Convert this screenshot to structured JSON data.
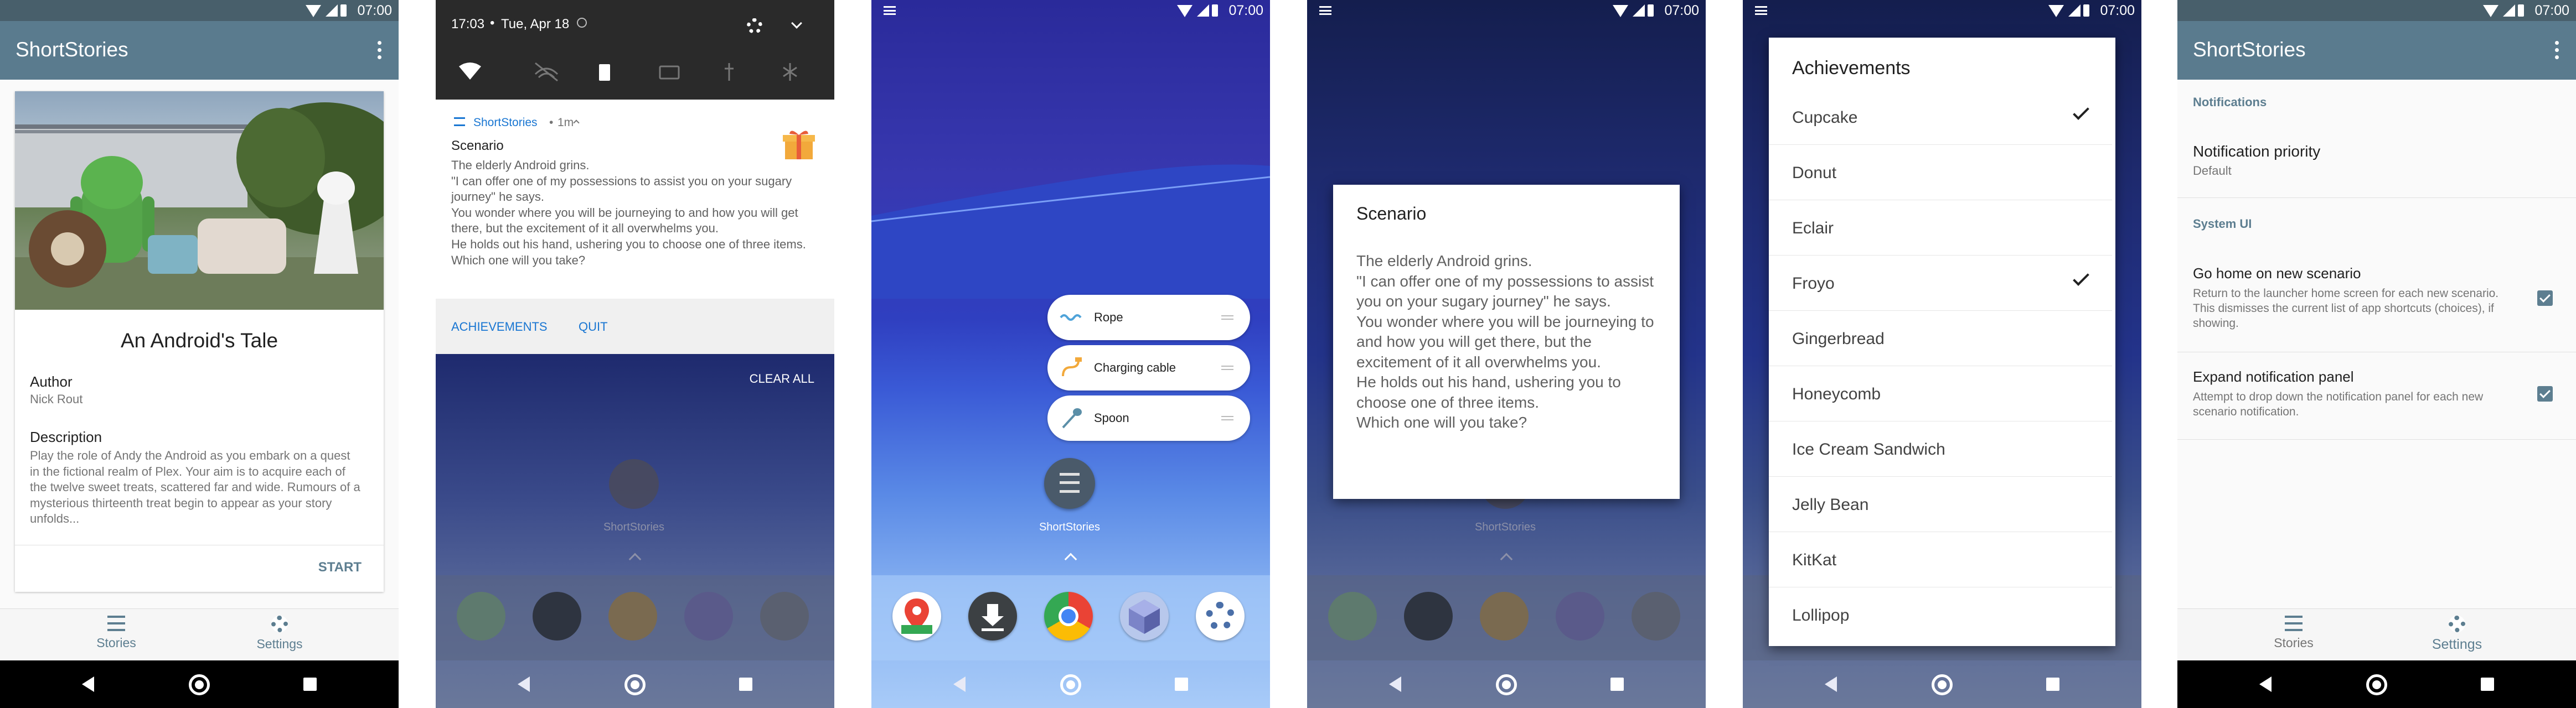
{
  "status": {
    "time": "07:00"
  },
  "app_title": "ShortStories",
  "panel1": {
    "story_title": "An Android's Tale",
    "author_label": "Author",
    "author_value": "Nick Rout",
    "description_label": "Description",
    "description_text": "Play the role of Andy the Android as you embark on a quest in the fictional realm of Plex. Your aim is to acquire each of the twelve sweet treats, scattered far and wide. Rumours of a mysterious thirteenth treat begin to appear as your story unfolds...",
    "start_button": "START",
    "nav_stories": "Stories",
    "nav_settings": "Settings"
  },
  "panel2": {
    "time": "17:03",
    "date": "Tue, Apr 18",
    "app_name": "ShortStories",
    "age": "1m",
    "notif_title": "Scenario",
    "notif_body": "The elderly Android grins.\n\"I can offer one of my possessions to assist you on your sugary journey\" he says.\nYou wonder where you will be journeying to and how you will get there, but the excitement of it all overwhelms you.\nHe holds out his hand, ushering you to choose one of three items.\nWhich one will you take?",
    "action_achievements": "ACHIEVEMENTS",
    "action_quit": "QUIT",
    "clear_all": "CLEAR ALL",
    "home_app_label": "ShortStories"
  },
  "panel3": {
    "shortcuts": [
      "Rope",
      "Charging cable",
      "Spoon"
    ],
    "app_label": "ShortStories"
  },
  "panel4": {
    "dialog_title": "Scenario",
    "dialog_body": "The elderly Android grins.\n\"I can offer one of my possessions to assist you on your sugary journey\" he says.\nYou wonder where you will be journeying to and how you will get there, but the excitement of it all overwhelms you.\nHe holds out his hand, ushering you to choose one of three items.\nWhich one will you take?",
    "app_label": "ShortStories"
  },
  "panel5": {
    "dialog_title": "Achievements",
    "items": [
      {
        "label": "Cupcake",
        "checked": true
      },
      {
        "label": "Donut",
        "checked": false
      },
      {
        "label": "Eclair",
        "checked": false
      },
      {
        "label": "Froyo",
        "checked": true
      },
      {
        "label": "Gingerbread",
        "checked": false
      },
      {
        "label": "Honeycomb",
        "checked": false
      },
      {
        "label": "Ice Cream Sandwich",
        "checked": false
      },
      {
        "label": "Jelly Bean",
        "checked": false
      },
      {
        "label": "KitKat",
        "checked": false
      },
      {
        "label": "Lollipop",
        "checked": false
      }
    ]
  },
  "panel6": {
    "cat_notifications": "Notifications",
    "priority_title": "Notification priority",
    "priority_value": "Default",
    "cat_system_ui": "System UI",
    "go_home_title": "Go home on new scenario",
    "go_home_desc": "Return to the launcher home screen for each new scenario. This dismisses the current list of app shortcuts (choices), if showing.",
    "expand_title": "Expand notification panel",
    "expand_desc": "Attempt to drop down the notification panel for each new scenario notification.",
    "nav_stories": "Stories",
    "nav_settings": "Settings"
  },
  "colors": {
    "appbar": "#5a7b8e",
    "accent": "#1976d2",
    "wallpaper_top": "#2a2a9a",
    "wallpaper_bottom": "#90b8f0"
  }
}
